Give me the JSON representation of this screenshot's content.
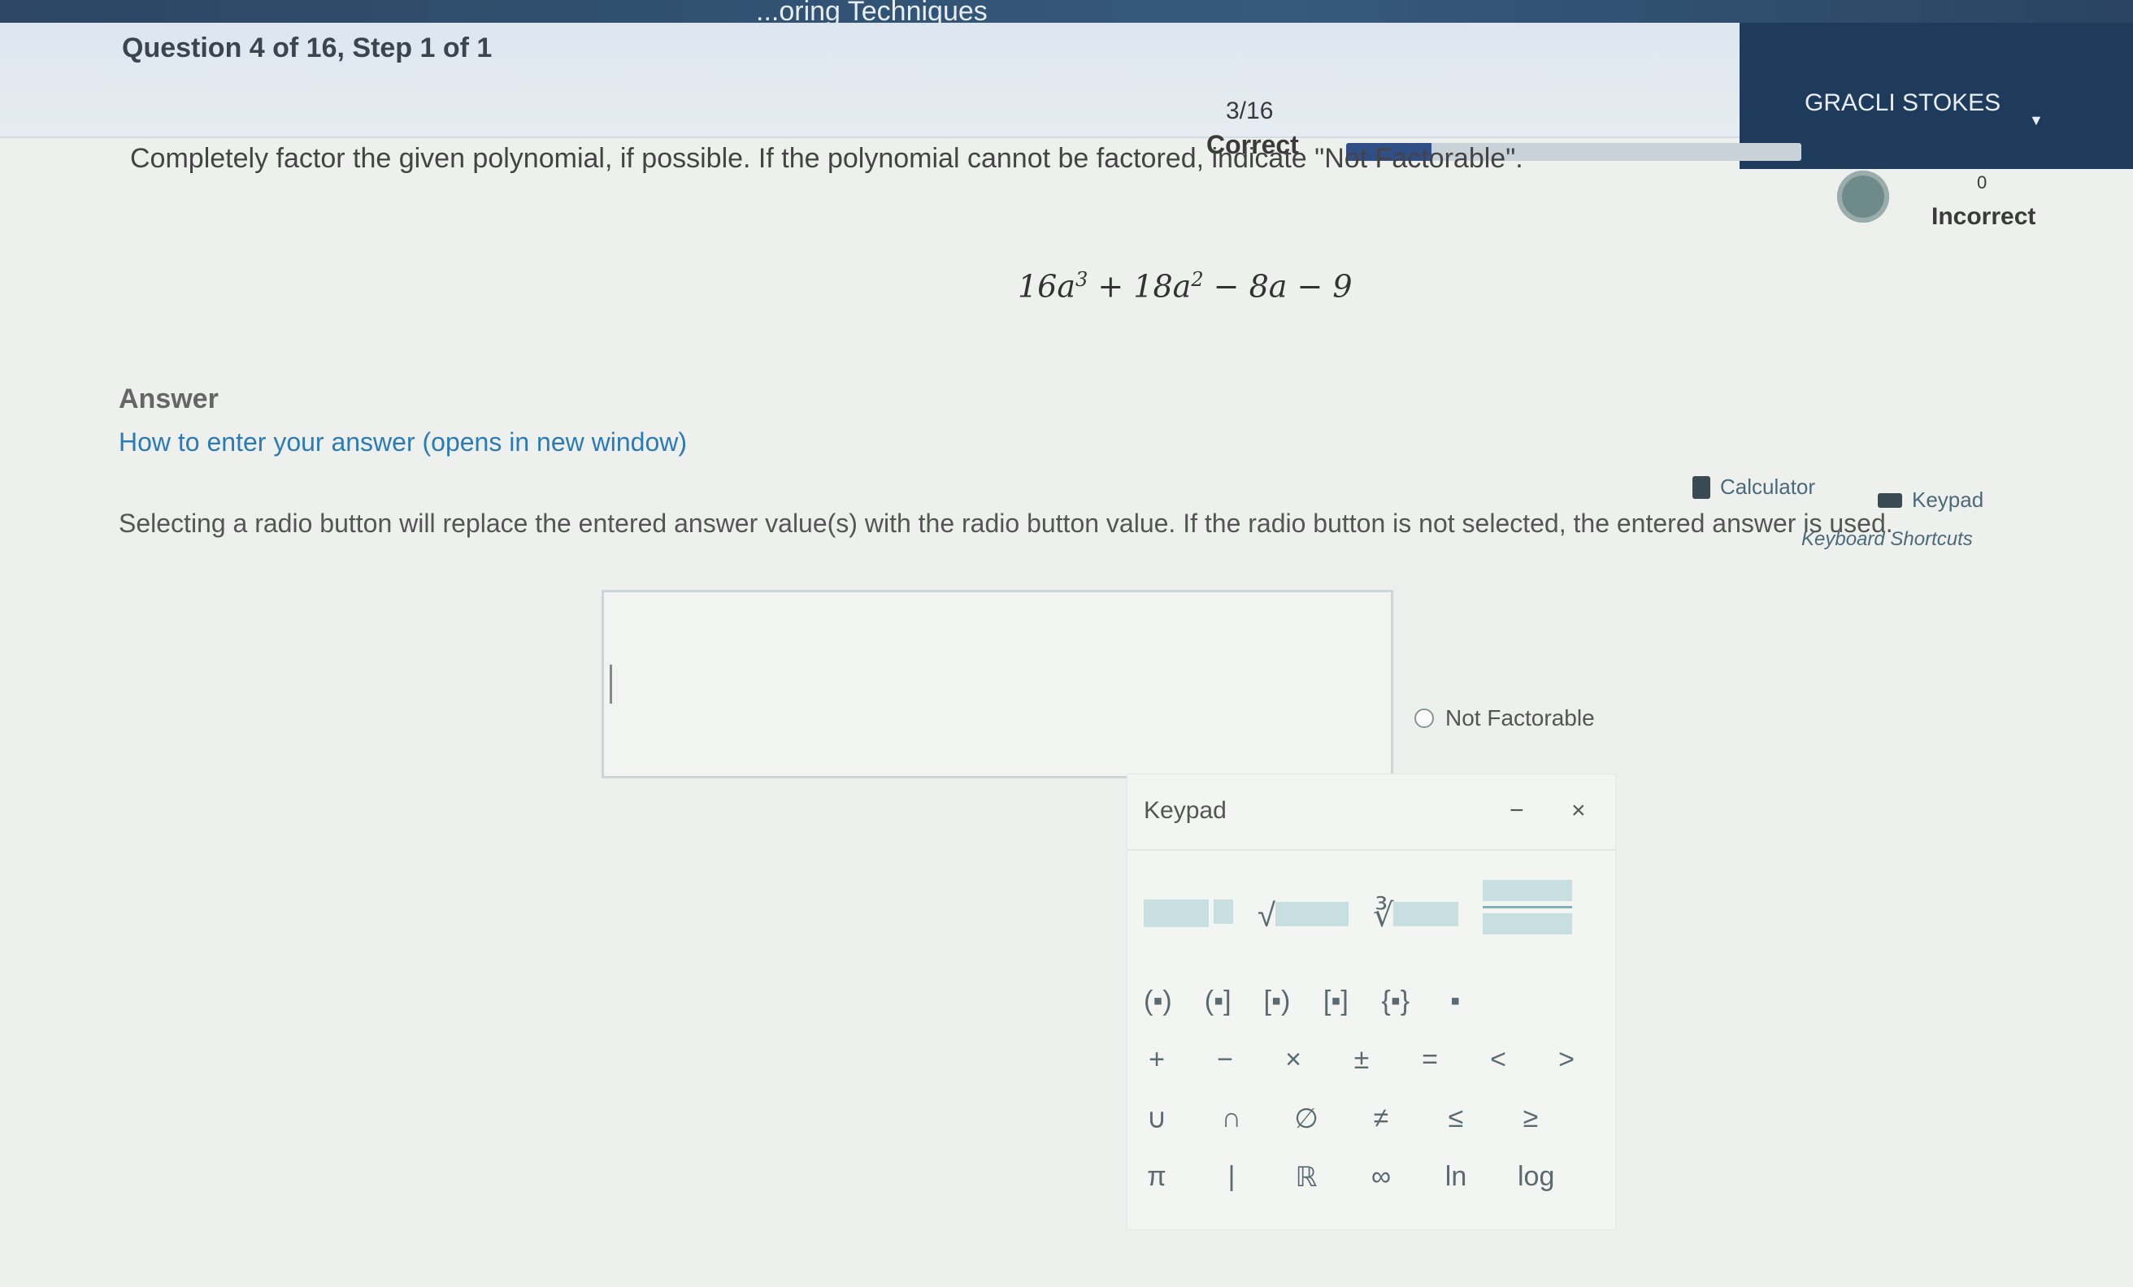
{
  "header": {
    "title": "...oring Techniques",
    "question_info": "Question 4 of 16,  Step 1 of 1",
    "score_fraction": "3/16",
    "score_label": "Correct",
    "progress": 0.1875,
    "user_name": "GRACLI STOKES",
    "incorrect_count": "0",
    "incorrect_label": "Incorrect"
  },
  "question": {
    "prompt": "Completely factor the given polynomial, if possible. If the polynomial cannot be factored, indicate \"Not Factorable\".",
    "polynomial": {
      "t1": "16a",
      "e1": "3",
      "t2": " + 18a",
      "e2": "2",
      "t3": " − 8a − 9"
    }
  },
  "answer": {
    "label": "Answer",
    "how_to_link": "How to enter your answer (opens in new window)",
    "tools": {
      "calculator": "Calculator",
      "keypad": "Keypad",
      "shortcuts": "Keyboard Shortcuts"
    },
    "radio_notice": "Selecting a radio button will replace the entered answer value(s) with the radio button value. If the radio button is not selected, the entered answer is used.",
    "radio_option": "Not Factorable",
    "input_value": ""
  },
  "keypad": {
    "title": "Keypad",
    "minimize": "−",
    "close": "×",
    "row2": [
      "(▪)",
      "(▪]",
      "[▪)",
      "[▪]",
      "{▪}",
      "▪"
    ],
    "row3": [
      "+",
      "−",
      "×",
      "±",
      "=",
      "<",
      ">"
    ],
    "row4": [
      "∪",
      "∩",
      "∅",
      "≠",
      "≤",
      "≥"
    ],
    "row5": [
      "π",
      "|",
      "ℝ",
      "∞",
      "ln",
      "log"
    ]
  },
  "colors": {
    "header_dark": "#1f3b5c",
    "link": "#2b7bb6",
    "progress_fill": "#2f4f86"
  }
}
